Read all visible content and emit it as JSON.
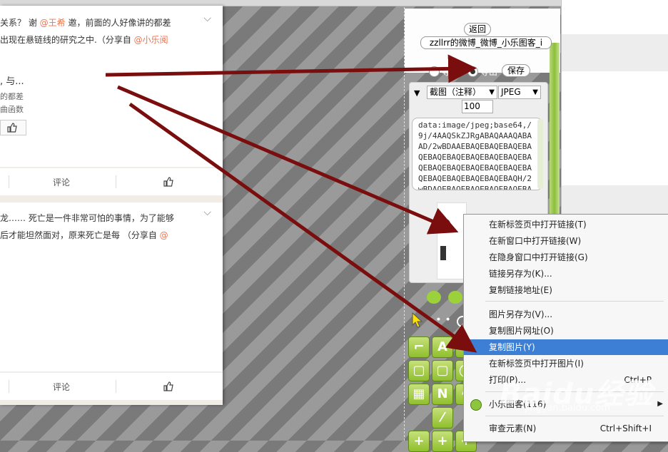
{
  "feed": {
    "post1": {
      "line1_prefix": "关系？ 谢 ",
      "line1_mention": "@王希",
      "line1_suffix": " 邀，前面的人好像讲的都差",
      "line2_prefix": "出现在悬链线的研究之中.（分享自 ",
      "line2_mention": "@小乐阅",
      "card_title": ", 与...",
      "card_line1": "的都差",
      "card_line2": "曲函数",
      "comment_label": "评论"
    },
    "post2": {
      "line1": "龙…… 死亡是一件非常可怕的事情，为了能够",
      "line2_prefix": "后才能坦然面对，原来死亡是每 （分享自 ",
      "line2_mention": "@",
      "comment_label": "评论"
    }
  },
  "app": {
    "back_label": "返回",
    "title_value": "zzllrr的微博_微博_小乐图客_i",
    "import_label": "导入",
    "export_label": "导出",
    "save_label": "保存",
    "expand_glyph": "▼",
    "mode_select": "截图（注释）",
    "format_select": "JPEG",
    "quality_value": "100",
    "data_url_lines": [
      "data:image/jpeg;base64,/",
      "9j/4AAQSkZJRgABAQAAAQABA",
      "AD/2wBDAAEBAQEBAQEBAQEBA",
      "QEBAQEBAQEBAQEBAQEBAQEBA",
      "QEBAQEBAQEBAQEBAQEBAQEBA",
      "QEBAQEBAQEBAQEBAQEBAQH/2",
      "wBDAQEBAQEBAQEBAQEBAQEBA"
    ],
    "tools_row1": [
      "",
      "A",
      ""
    ],
    "tools_row3": [
      "",
      "N",
      ""
    ]
  },
  "context_menu": {
    "items": [
      {
        "label": "在新标签页中打开链接(T)",
        "shortcut": ""
      },
      {
        "label": "在新窗口中打开链接(W)",
        "shortcut": ""
      },
      {
        "label": "在隐身窗口中打开链接(G)",
        "shortcut": ""
      },
      {
        "label": "链接另存为(K)...",
        "shortcut": ""
      },
      {
        "label": "复制链接地址(E)",
        "shortcut": ""
      },
      {
        "label": "图片另存为(V)...",
        "shortcut": ""
      },
      {
        "label": "复制图片网址(O)",
        "shortcut": ""
      },
      {
        "label": "复制图片(Y)",
        "shortcut": ""
      },
      {
        "label": "在新标签页中打开图片(I)",
        "shortcut": ""
      },
      {
        "label": "打印(P)...",
        "shortcut": "Ctrl+P"
      },
      {
        "label": "小乐图客(116)",
        "shortcut": ""
      },
      {
        "label": "审查元素(N)",
        "shortcut": "Ctrl+Shift+I"
      }
    ],
    "highlighted_index": 7
  },
  "watermark": {
    "main": "Baidu经验",
    "sub": "jingyan.baidu.com"
  },
  "colors": {
    "accent_mention": "#eb7350",
    "menu_highlight": "#3e7fd6",
    "arrow": "#7a0d0d",
    "tool_green": "#8fbf2e"
  }
}
